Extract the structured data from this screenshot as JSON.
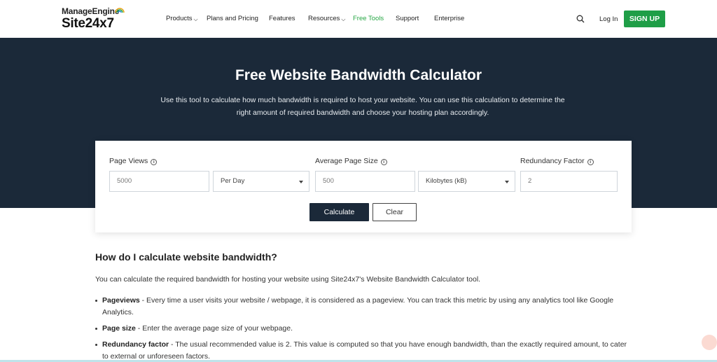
{
  "nav": {
    "brand_top": "ManageEngine",
    "brand_bottom": "Site24x7",
    "items": [
      {
        "label": "Products"
      },
      {
        "label": "Plans and Pricing"
      },
      {
        "label": "Features"
      },
      {
        "label": "Resources"
      },
      {
        "label": "Free Tools"
      },
      {
        "label": "Support"
      },
      {
        "label": "Enterprise"
      }
    ],
    "login": "Log In",
    "signup": "SIGN UP",
    "accent_color": "#27a745"
  },
  "hero": {
    "title": "Free Website Bandwidth Calculator",
    "desc_line1": "Use this tool to calculate how much bandwidth is required to host your website. You can use this calculation to determine the",
    "desc_line2": "right amount of required bandwidth and choose your hosting plan accordingly.",
    "bg_color": "#1b2939"
  },
  "calculator": {
    "page_views_label": "Page Views",
    "page_views_placeholder": "5000",
    "period_value": "Per Day",
    "avg_size_label": "Average Page Size",
    "avg_size_placeholder": "500",
    "unit_value": "Kilobytes (kB)",
    "redundancy_label": "Redundancy Factor",
    "redundancy_value": "2",
    "info_glyph": "i",
    "calculate": "Calculate",
    "clear": "Clear"
  },
  "content": {
    "heading": "How do I calculate website bandwidth?",
    "intro": "You can calculate the required bandwidth for hosting your website using Site24x7's Website Bandwidth Calculator tool.",
    "bullets": [
      {
        "term": "Pageviews",
        "text": " - Every time a user visits your website / webpage, it is considered as a pageview. You can track this metric by using any analytics tool like Google Analytics."
      },
      {
        "term": "Page size",
        "text": " - Enter the average page size of your webpage."
      },
      {
        "term": "Redundancy factor",
        "text": " - The usual recommended value is 2. This value is computed so that you have enough bandwidth, than the exactly required amount, to cater to external or unforeseen factors."
      }
    ]
  }
}
